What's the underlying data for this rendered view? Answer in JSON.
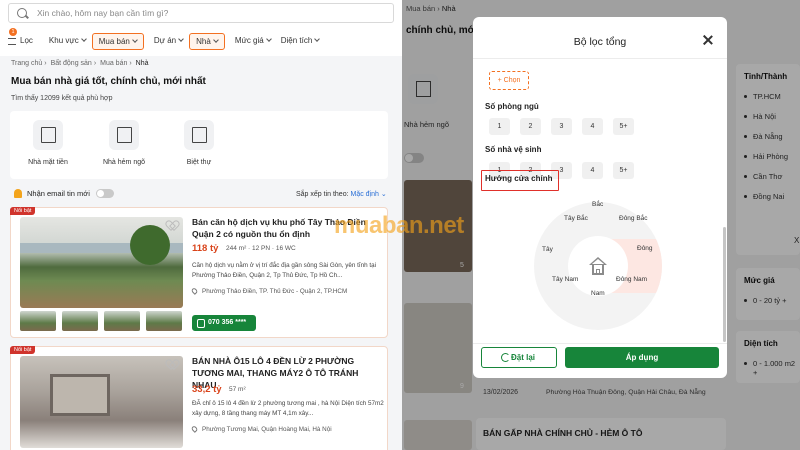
{
  "search": {
    "placeholder": "Xin chào, hôm nay bạn cần tìm gì?"
  },
  "filters": {
    "badge": "1",
    "items": [
      {
        "label": "Lọc"
      },
      {
        "label": "Khu vực"
      },
      {
        "label": "Mua bán"
      },
      {
        "label": "Dự án"
      },
      {
        "label": "Nhà"
      },
      {
        "label": "Mức giá"
      },
      {
        "label": "Diện tích"
      }
    ]
  },
  "breadcrumb": [
    "Trang chủ",
    "Bất động sản",
    "Mua bán",
    "Nhà"
  ],
  "page": {
    "title": "Mua bán nhà giá tốt, chính chủ, mới nhất",
    "count": "Tìm thấy 12099 kết quả phù hợp"
  },
  "categories": [
    {
      "label": "Nhà mặt tiền",
      "icon": "storefront-icon"
    },
    {
      "label": "Nhà hẻm ngõ",
      "icon": "alley-house-icon"
    },
    {
      "label": "Biệt thự",
      "icon": "villa-icon"
    }
  ],
  "notify": {
    "label": "Nhận email tin mới",
    "enabled": false
  },
  "sort": {
    "label": "Sắp xếp tin theo:",
    "value": "Mặc định"
  },
  "listings": [
    {
      "badge": "Nổi bật",
      "title": "Bán căn hộ dịch vụ khu phố Tây Thảo Điền Quận 2 có nguồn thu ổn định",
      "price": "118 tỷ",
      "meta": "244 m² · 12 PN · 16 WC",
      "desc": "Căn hộ dịch vụ nằm ở vị trí đắc địa gần sông Sài Gòn, yên tĩnh tại Phường Thảo Điền, Quận 2, Tp Thủ Đức, Tp Hồ Ch...",
      "address": "Phường Thảo Điền, TP. Thủ Đức - Quận 2, TP.HCM",
      "phone": "070 356 ****"
    },
    {
      "badge": "Nổi bật",
      "title": "BÁN NHÀ Ô15 LÔ 4 ĐỀN LỪ 2 PHƯỜNG TƯƠNG MAI, THANG MÁY2 Ô TÔ TRÁNH NHAU",
      "price": "33,2 tỷ",
      "meta": "57 m²",
      "desc": "ĐÃ chỉ ô 15 lô 4 đền lừ 2 phường tương mai , hà Nội Diện tích 57m2 xây dựng, 8 tầng thang máy MT 4,1m xây...",
      "address": "Phường Tương Mai, Quận Hoàng Mai, Hà Nội"
    }
  ],
  "background": {
    "breadcrumb": [
      "Mua bán",
      "Nhà"
    ],
    "title": "chính chủ, mới",
    "category_label": "Nhà hẻm ngõ",
    "photo_counts": [
      "5",
      "9"
    ],
    "listing_date": "13/02/2026",
    "listing_address": "Phường Hòa Thuận Đông, Quận Hải Châu, Đà Nẵng",
    "listing_title": "BÁN GẤP NHÀ CHÍNH CHỦ - HẺM Ô TÔ",
    "sidebar_cities": {
      "title": "Tỉnh/Thành",
      "items": [
        "TP.HCM",
        "Hà Nội",
        "Đà Nẵng",
        "Hải Phòng",
        "Cần Thơ",
        "Đồng Nai"
      ],
      "more": "X"
    },
    "sidebar_price": {
      "title": "Mức giá",
      "items": [
        "0 - 20 tỷ +"
      ]
    },
    "sidebar_area": {
      "title": "Diện tích",
      "items": [
        "0 - 1.000 m2 +"
      ]
    }
  },
  "watermark": "muaban.net",
  "modal": {
    "title": "Bộ lọc tổng",
    "choose_label": "+ Chọn",
    "bedrooms": {
      "label": "Số phòng ngủ",
      "options": [
        "1",
        "2",
        "3",
        "4",
        "5+"
      ]
    },
    "bathrooms": {
      "label": "Số nhà vệ sinh",
      "options": [
        "1",
        "2",
        "3",
        "4",
        "5+"
      ]
    },
    "direction": {
      "label": "Hướng cửa chính",
      "options": [
        "Bắc",
        "Đông Bắc",
        "Đông",
        "Đông Nam",
        "Nam",
        "Tây Nam",
        "Tây",
        "Tây Bắc"
      ],
      "highlighted": "Đông"
    },
    "reset_label": "Đặt lại",
    "apply_label": "Áp dụng"
  },
  "colors": {
    "accent_orange": "#f37021",
    "primary_green": "#17853a",
    "price_red": "#d9441b",
    "badge_red": "#d0342c",
    "highlight_pink": "#fde7e2"
  }
}
